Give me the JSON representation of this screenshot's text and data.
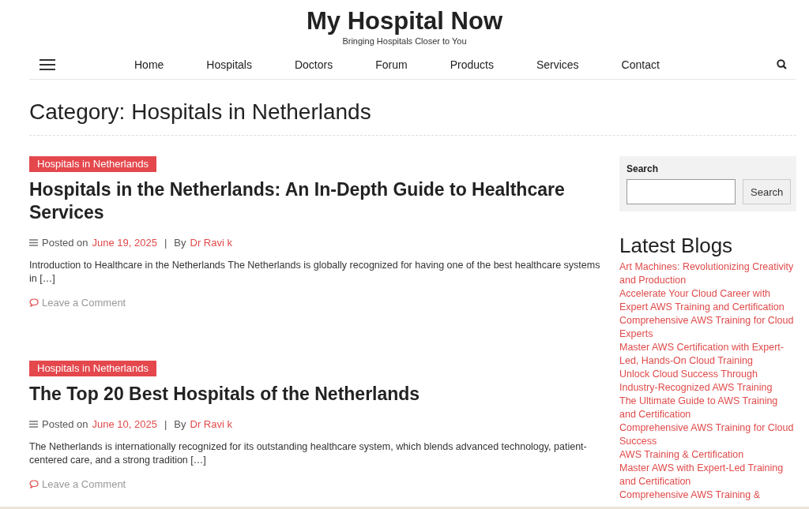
{
  "site": {
    "title": "My Hospital Now",
    "tagline": "Bringing Hospitals Closer to You"
  },
  "nav": {
    "items": [
      "Home",
      "Hospitals",
      "Doctors",
      "Forum",
      "Products",
      "Services",
      "Contact"
    ]
  },
  "page_heading": "Category: Hospitals in Netherlands",
  "posts": [
    {
      "category": "Hospitals in Netherlands",
      "title": "Hospitals in the Netherlands: An In-Depth Guide to Healthcare Services",
      "posted_label": "Posted on",
      "date": "June 19, 2025",
      "separator": "|",
      "by_label": "By",
      "author": "Dr Ravi k",
      "excerpt": "Introduction to Healthcare in the Netherlands The Netherlands is globally recognized for having one of the best healthcare systems in […]",
      "comment_link": "Leave a Comment"
    },
    {
      "category": "Hospitals in Netherlands",
      "title": "The Top 20 Best Hospitals of the Netherlands",
      "posted_label": "Posted on",
      "date": "June 10, 2025",
      "separator": "|",
      "by_label": "By",
      "author": "Dr Ravi k",
      "excerpt": "The Netherlands is internationally recognized for its outstanding healthcare system, which blends advanced technology, patient-centered care, and a strong tradition […]",
      "comment_link": "Leave a Comment"
    }
  ],
  "sidebar": {
    "search": {
      "label": "Search",
      "button": "Search"
    },
    "latest_title": "Latest Blogs",
    "latest": [
      "Art Machines: Revolutionizing Creativity and Production",
      "Accelerate Your Cloud Career with Expert AWS Training and Certification",
      "Comprehensive AWS Training for Cloud Experts",
      "Master AWS Certification with Expert-Led, Hands-On Cloud Training",
      "Unlock Cloud Success Through Industry-Recognized AWS Training",
      "The Ultimate Guide to AWS Training and Certification",
      "Comprehensive AWS Training for Cloud Success",
      "AWS Training & Certification",
      "Master AWS with Expert-Led Training and Certification",
      "Comprehensive AWS Training &"
    ]
  }
}
